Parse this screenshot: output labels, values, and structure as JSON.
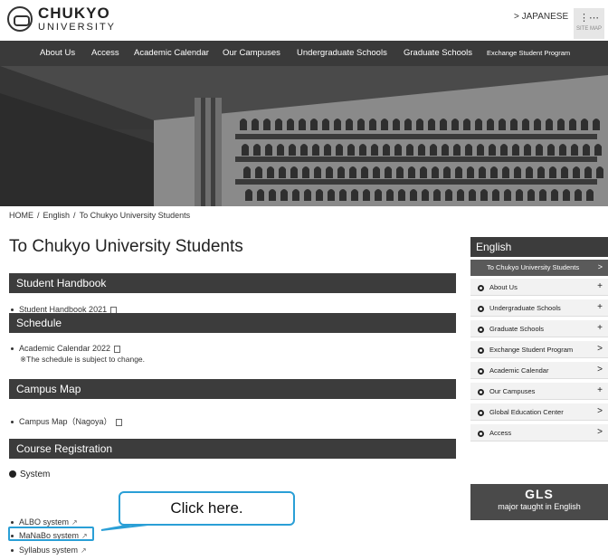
{
  "header": {
    "logo_name": "CHUKYO",
    "logo_sub": "UNIVERSITY",
    "lang_link": "> JAPANESE",
    "sitemap_label": "SITE MAP"
  },
  "nav": [
    "About Us",
    "Access",
    "Academic Calendar",
    "Our Campuses",
    "Undergraduate Schools",
    "Graduate Schools",
    "Exchange Student Program"
  ],
  "breadcrumb": [
    "HOME",
    "English",
    "To Chukyo University Students"
  ],
  "page_title": "To Chukyo University Students",
  "sections": {
    "handbook": {
      "title": "Student Handbook",
      "item": "Student Handbook 2021"
    },
    "schedule": {
      "title": "Schedule",
      "item": "Academic Calendar 2022",
      "note": "※The schedule is subject to change."
    },
    "campus_map": {
      "title": "Campus Map",
      "item": "Campus Map（Nagoya）"
    },
    "course_registration": {
      "title": "Course Registration",
      "system_head": "System",
      "items": [
        "ALBO system",
        "MaNaBo system",
        "Syllabus system"
      ]
    }
  },
  "callout": "Click here.",
  "sidebar": {
    "head": "English",
    "active": "To Chukyo University Students",
    "items": [
      {
        "label": "About Us",
        "suffix": "+"
      },
      {
        "label": "Undergraduate Schools",
        "suffix": "+"
      },
      {
        "label": "Graduate Schools",
        "suffix": "+"
      },
      {
        "label": "Exchange Student Program",
        "suffix": ">"
      },
      {
        "label": "Academic Calendar",
        "suffix": ">"
      },
      {
        "label": "Our Campuses",
        "suffix": "+"
      },
      {
        "label": "Global Education Center",
        "suffix": ">"
      },
      {
        "label": "Access",
        "suffix": ">"
      }
    ]
  },
  "gls": {
    "title": "GLS",
    "subtitle": "major taught in English"
  },
  "colors": {
    "nav_bg": "#3a3a3a",
    "section_bg": "#3c3c3c",
    "highlight": "#2a9fd6"
  }
}
